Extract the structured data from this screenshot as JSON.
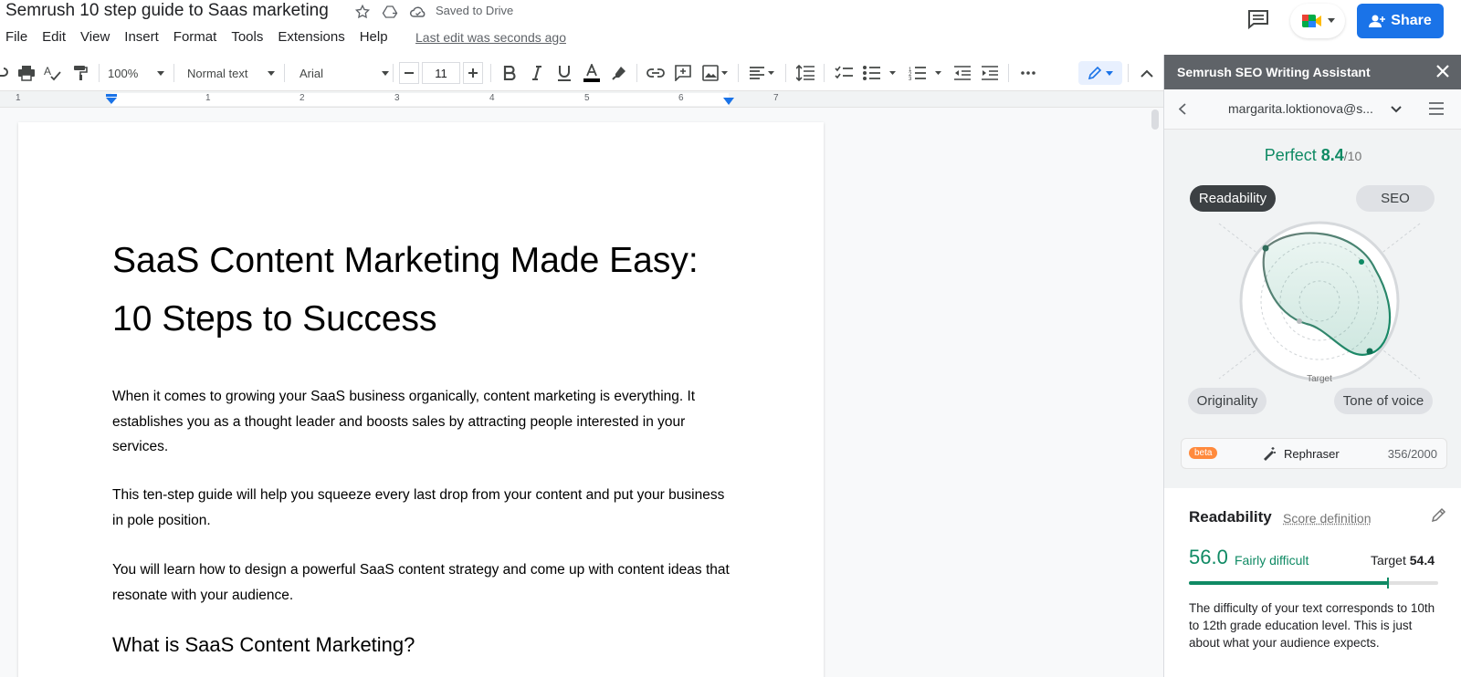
{
  "titlebar": {
    "doc_title": "Semrush 10 step guide to Saas marketing",
    "saved_status": "Saved to Drive",
    "last_edit": "Last edit was seconds ago",
    "share_label": "Share"
  },
  "menu": [
    "File",
    "Edit",
    "View",
    "Insert",
    "Format",
    "Tools",
    "Extensions",
    "Help"
  ],
  "toolbar": {
    "zoom": "100%",
    "style": "Normal text",
    "font": "Arial",
    "font_size": "11"
  },
  "ruler": [
    "1",
    "1",
    "2",
    "3",
    "4",
    "5",
    "6",
    "7"
  ],
  "document": {
    "title": "SaaS Content Marketing Made Easy: 10 Steps to Success",
    "paragraphs": [
      "When it comes to growing your SaaS business organically, content marketing is everything. It establishes you as a thought leader and boosts sales by attracting people interested in your services.",
      "This ten-step guide will help you squeeze every last drop from your content and put your business in pole position.",
      "You will learn how to design a powerful SaaS content strategy and come up with content ideas that resonate with your audience."
    ],
    "heading2": "What is SaaS Content Marketing?"
  },
  "panel": {
    "title": "Semrush SEO Writing Assistant",
    "account": "margarita.loktionova@s...",
    "score_label": "Perfect",
    "score_value": "8.4",
    "score_max": "/10",
    "tabs": {
      "readability": "Readability",
      "seo": "SEO",
      "originality": "Originality",
      "tone": "Tone of voice"
    },
    "radar_target_label": "Target",
    "beta_label": "beta",
    "rephraser_label": "Rephraser",
    "rephraser_count": "356/2000",
    "readability": {
      "title": "Readability",
      "definition_link": "Score definition",
      "score": "56.0",
      "level": "Fairly difficult",
      "target_label": "Target",
      "target_value": "54.4",
      "progress_fraction": 0.8,
      "description": "The difficulty of your text corresponds to 10th to 12th grade education level. This is just about what your audience expects."
    }
  },
  "colors": {
    "accent_green": "#0f8a64",
    "share_blue": "#1a73e8",
    "beta_orange": "#ff8a3d"
  }
}
